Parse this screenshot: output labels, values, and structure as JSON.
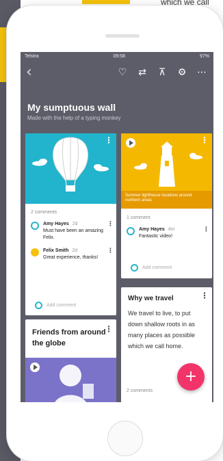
{
  "background": {
    "right_top_text": "which we call hom"
  },
  "status": {
    "carrier": "Telstra",
    "time": "09:58",
    "battery": "97%"
  },
  "toolbar": {
    "icons": [
      "back-arrow-icon",
      "heart-icon",
      "repost-icon",
      "org-chart-icon",
      "gear-icon",
      "more-icon"
    ]
  },
  "wall": {
    "title": "My sumptuous wall",
    "subtitle": "Made with the help of a typing monkey"
  },
  "cards": {
    "balloon": {
      "count": "2 comments",
      "comments": [
        {
          "name": "Amy Hayes",
          "time": "2d",
          "text": "Must have been an amazing Felix."
        },
        {
          "name": "Felix Smith",
          "time": "2d",
          "text": "Great experience, thanks!"
        }
      ],
      "add": "Add comment"
    },
    "lighthouse": {
      "caption": "Summer lighthouse locations around northern areas",
      "count": "1 comment",
      "comments": [
        {
          "name": "Amy Hayes",
          "time": "4m",
          "text": "Fantastic video!"
        }
      ],
      "add": "Add comment"
    },
    "friends": {
      "title": "Friends from around the globe"
    },
    "travel": {
      "title": "Why we travel",
      "body": "We travel to live, to put down shallow roots in as many places as possible which we call home.",
      "count": "2 comments"
    }
  },
  "fab": {
    "label": "+"
  },
  "colors": {
    "cyan": "#22b4cd",
    "yellow": "#f5b800",
    "purple": "#7b73c9",
    "pink": "#f2346b",
    "wall": "#5c5d68"
  }
}
